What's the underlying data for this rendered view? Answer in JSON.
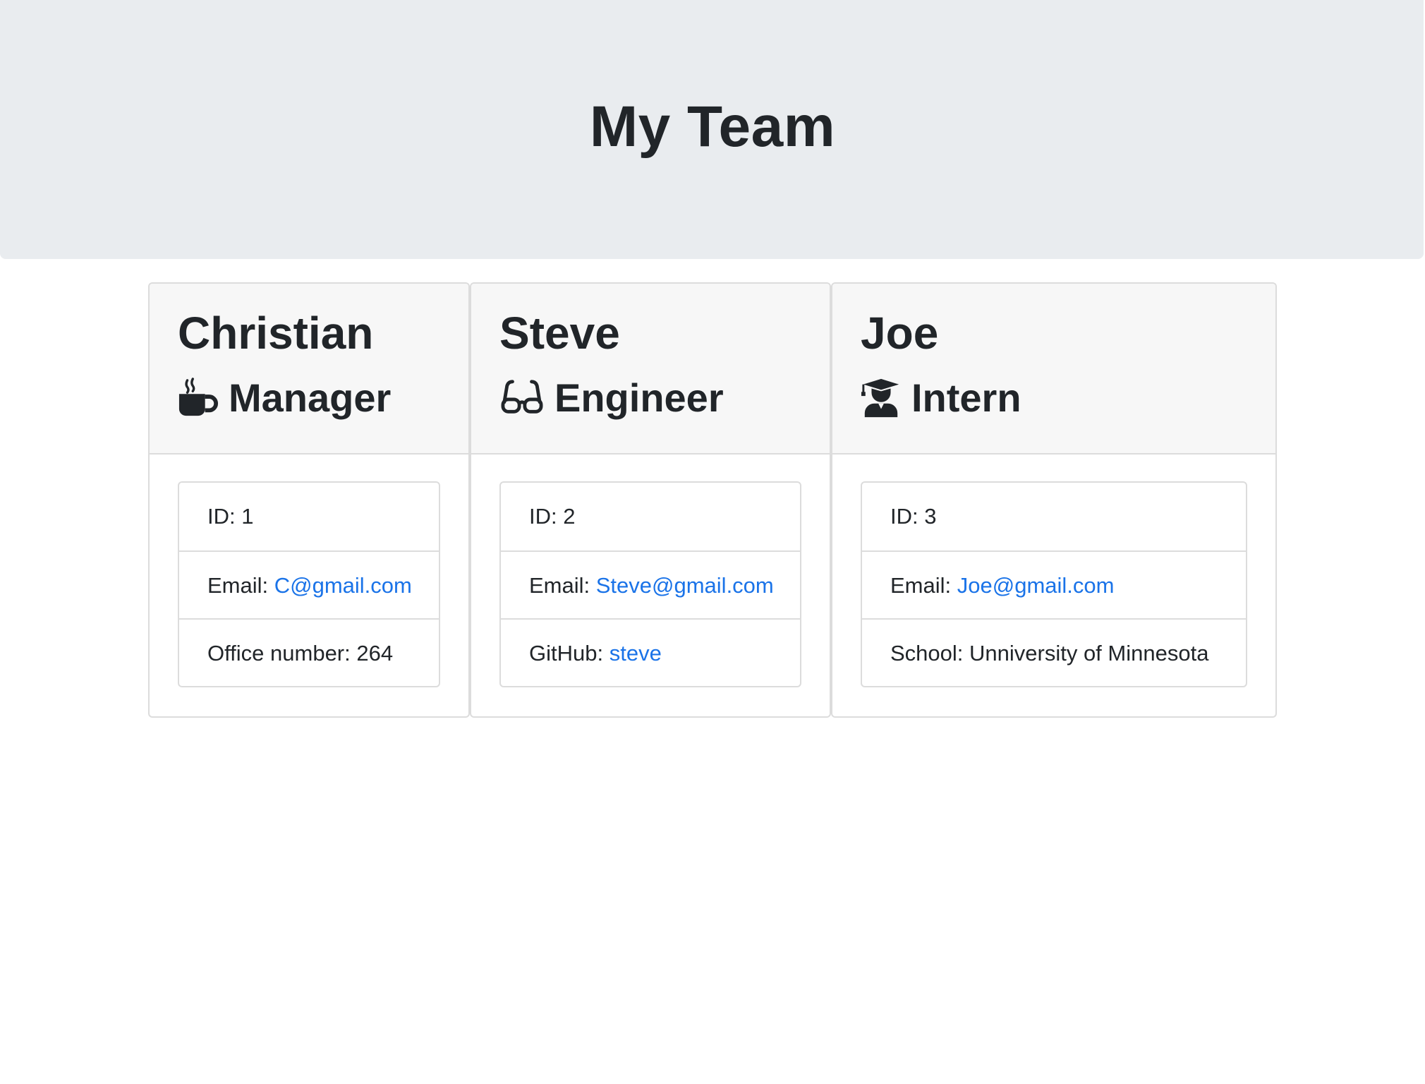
{
  "header": {
    "title": "My Team"
  },
  "team": [
    {
      "name": "Christian",
      "role": "Manager",
      "role_icon": "coffee-mug-icon",
      "id_text": "ID: 1",
      "email_label": "Email: ",
      "email": "C@gmail.com",
      "extra_label": "Office number: 264",
      "extra_value": ""
    },
    {
      "name": "Steve",
      "role": "Engineer",
      "role_icon": "glasses-icon",
      "id_text": "ID: 2",
      "email_label": "Email: ",
      "email": "Steve@gmail.com",
      "extra_label": "GitHub: ",
      "extra_value": "steve"
    },
    {
      "name": "Joe",
      "role": "Intern",
      "role_icon": "user-graduate-icon",
      "id_text": "ID: 3",
      "email_label": "Email: ",
      "email": "Joe@gmail.com",
      "extra_label": "School: Unniversity of Minnesota",
      "extra_value": ""
    }
  ],
  "colors": {
    "link": "#1a73e8",
    "jumbotron_bg": "#e9ecef",
    "card_header_bg": "#f7f7f7",
    "text": "#212529"
  }
}
